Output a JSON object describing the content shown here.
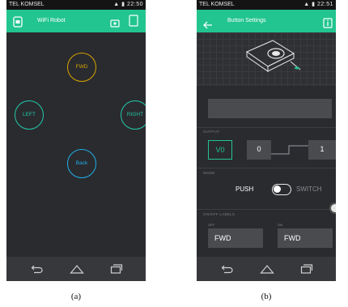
{
  "colors": {
    "accent": "#22c58f",
    "fwd": "#d9a400",
    "left": "#21c8a8",
    "right": "#21c8a8",
    "back": "#1fb0e8",
    "background": "#2a2b2f"
  },
  "panel_a": {
    "status": {
      "carrier": "TEL KOMSEL",
      "time": "22:50"
    },
    "appbar": {
      "title": "WiFi Robot"
    },
    "buttons": {
      "fwd": "FWD",
      "left": "LEFT",
      "right": "RIGHT",
      "back": "Back"
    },
    "caption": "(a)"
  },
  "panel_b": {
    "status": {
      "carrier": "TEL KOMSEL",
      "time": "22:51"
    },
    "appbar": {
      "title": "Button Settings"
    },
    "output": {
      "label": "OUTPUT",
      "pin": "V0",
      "low_value": "0",
      "high_value": "1"
    },
    "mode": {
      "label": "MODE",
      "push": "PUSH",
      "switch": "SWITCH"
    },
    "onoff": {
      "label": "ON/OFF LABELS",
      "off_label": "OFF",
      "on_label": "ON",
      "off_value": "FWD",
      "on_value": "FWD"
    },
    "caption": "(b)"
  }
}
